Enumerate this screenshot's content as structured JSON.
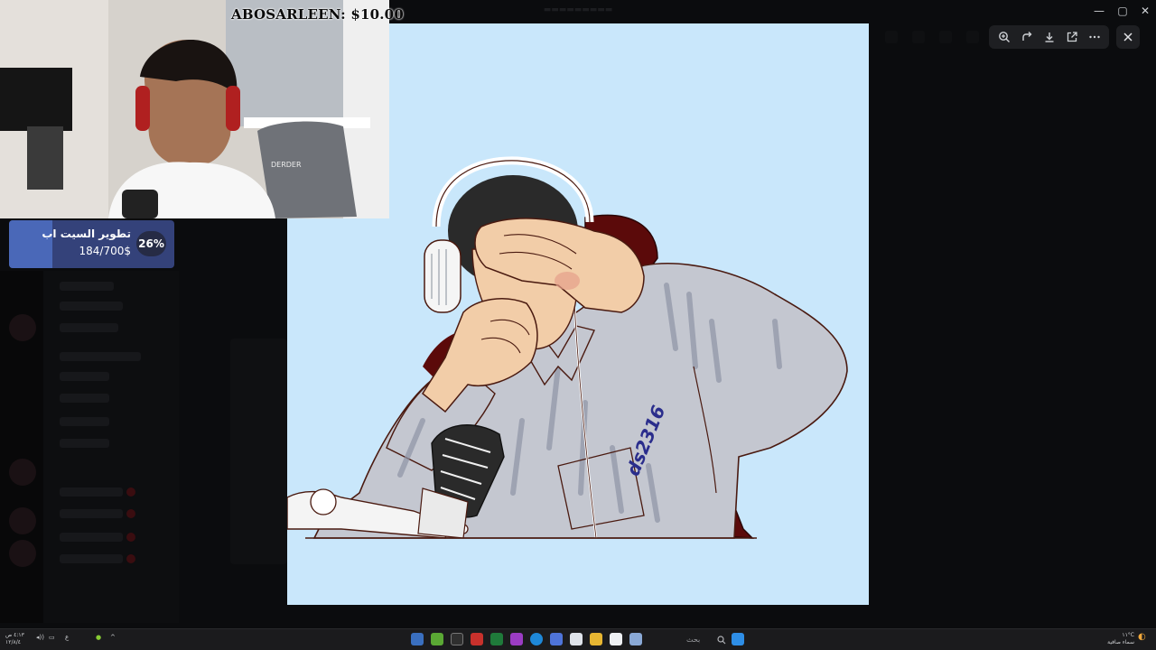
{
  "overlay": {
    "donation_text": "ABOSARLEEN: $10.00",
    "goal": {
      "title": "تطوير السيت اب",
      "amount": "184/700$",
      "percent_label": "26%",
      "progress": 0.26
    }
  },
  "artwork": {
    "signature": "ds2316"
  },
  "viewer_toolbar": {
    "tools": [
      "zoom-in",
      "rotate",
      "download",
      "open-external",
      "more"
    ]
  },
  "taskbar": {
    "search_label": "بحث",
    "clock_line1": "٤:١٣ ص",
    "clock_line2": "١٢/٨/٤",
    "weather_line1": "١١°C",
    "weather_line2": "سماء صافية"
  },
  "colors": {
    "artwork_bg": "#c9e7fb",
    "shirt": "#c4c7d0",
    "skin": "#f2cda8",
    "chair": "#5b0a0a",
    "goal_bg": "#34427a",
    "goal_fill": "#4a68b8"
  }
}
